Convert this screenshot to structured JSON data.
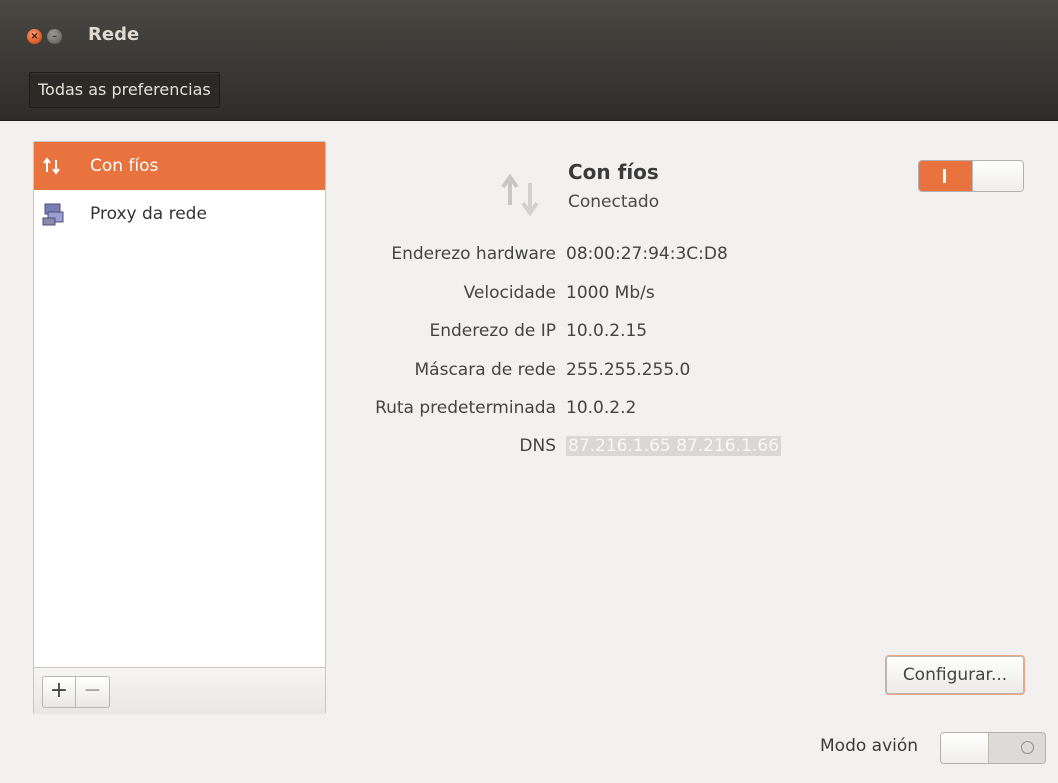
{
  "window": {
    "title": "Rede"
  },
  "toolbar": {
    "all_settings_label": "Todas as preferencias"
  },
  "sidebar": {
    "items": [
      {
        "label": "Con fíos",
        "icon": "wired-network-icon",
        "selected": true
      },
      {
        "label": "Proxy da rede",
        "icon": "network-proxy-icon",
        "selected": false
      }
    ],
    "add_label": "+",
    "remove_label": "−"
  },
  "connection": {
    "title": "Con fíos",
    "status": "Conectado",
    "enabled": true,
    "details": [
      {
        "label": "Enderezo hardware",
        "value": "08:00:27:94:3C:D8"
      },
      {
        "label": "Velocidade",
        "value": "1000 Mb/s"
      },
      {
        "label": "Enderezo de IP",
        "value": "10.0.2.15"
      },
      {
        "label": "Máscara de rede",
        "value": "255.255.255.0"
      },
      {
        "label": "Ruta predeterminada",
        "value": "10.0.2.2"
      },
      {
        "label": "DNS",
        "value": "87.216.1.65 87.216.1.66"
      }
    ],
    "configure_label": "Configurar..."
  },
  "airplane_mode": {
    "label": "Modo avión",
    "enabled": false
  },
  "colors": {
    "accent": "#e9733e",
    "titlebar": "#3c3b37",
    "background": "#f2f1f0"
  }
}
